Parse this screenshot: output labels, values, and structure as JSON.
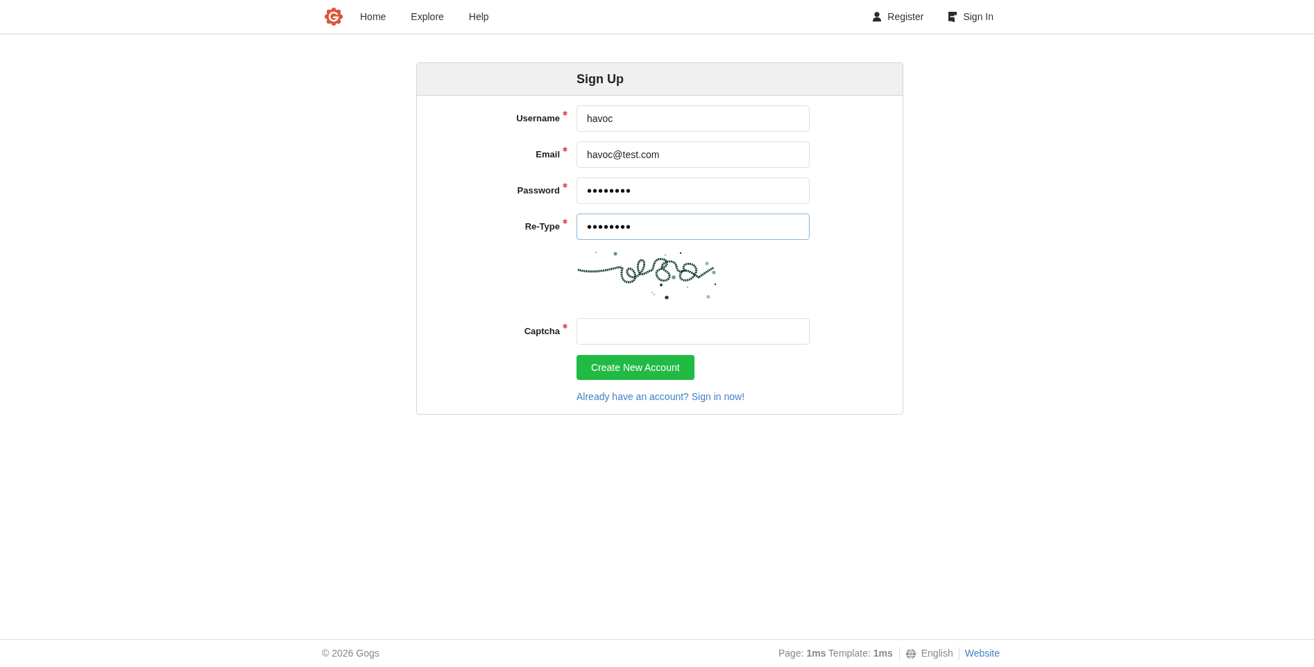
{
  "nav": {
    "items": [
      {
        "label": "Home"
      },
      {
        "label": "Explore"
      },
      {
        "label": "Help"
      }
    ],
    "register": {
      "label": "Register"
    },
    "sign_in": {
      "label": "Sign In"
    }
  },
  "form": {
    "title": "Sign Up",
    "fields": [
      {
        "kind": "text",
        "label": "Username",
        "required": true,
        "value": "havoc",
        "focused": false
      },
      {
        "kind": "text",
        "label": "Email",
        "required": true,
        "value": "havoc@test.com",
        "focused": false
      },
      {
        "kind": "password",
        "label": "Password",
        "required": true,
        "value": "••••••••",
        "focused": false
      },
      {
        "kind": "password",
        "label": "Re-Type",
        "required": true,
        "value": "••••••••",
        "focused": true
      },
      {
        "kind": "captcha",
        "label": "Captcha",
        "required": true,
        "focused": false
      }
    ],
    "submit": {
      "label": "Create New Account"
    },
    "signin_link": {
      "label": "Already have an account? Sign in now!"
    }
  },
  "footer": {
    "copyright": "© 2026 Gogs",
    "timing": "Page: **1ms** Template: **1ms**",
    "language": "English",
    "website": "Website"
  }
}
